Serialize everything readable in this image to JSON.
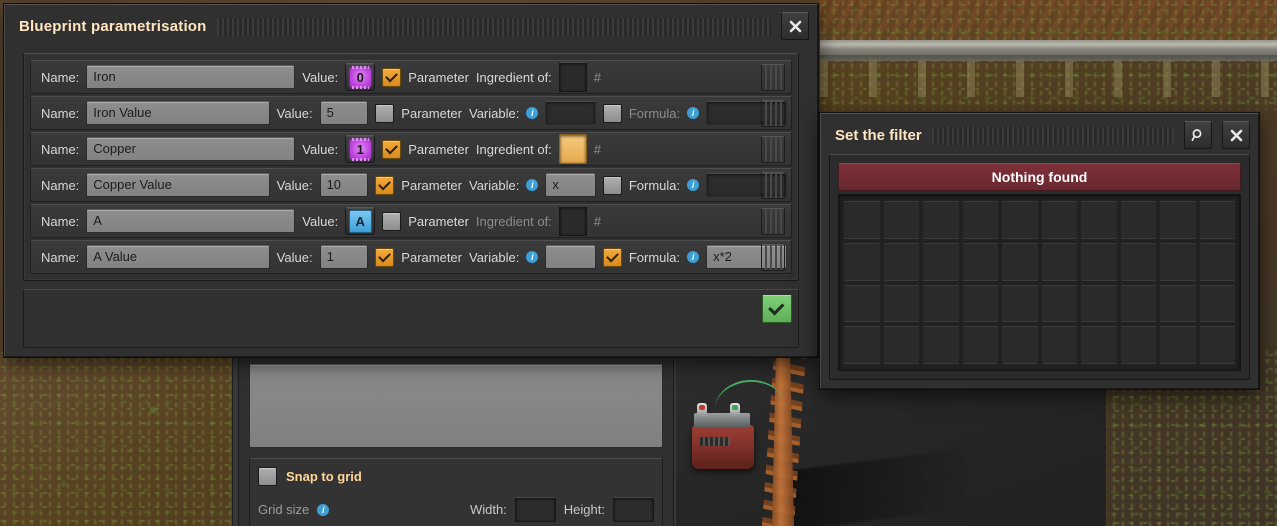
{
  "blueprint_window": {
    "title": "Blueprint parametrisation",
    "close_label": "✕",
    "confirm_label": "",
    "labels": {
      "name": "Name:",
      "value": "Value:",
      "parameter": "Parameter",
      "ingredient_of": "Ingredient of:",
      "variable": "Variable:",
      "formula": "Formula:",
      "hash": "#",
      "info": "i"
    },
    "rows": [
      {
        "name": "Iron",
        "value_type": "chip",
        "value": "0",
        "parameter_checked": true,
        "second_label": "Ingredient of:",
        "second_label_dim": false,
        "ingredient_filled": false,
        "hash": "#",
        "has_formula": false,
        "variable": "",
        "formula_checked": false,
        "formula": ""
      },
      {
        "name": "Iron Value",
        "value_type": "text",
        "value": "5",
        "parameter_checked": false,
        "second_label": "Variable:",
        "second_label_dim": false,
        "variable": "",
        "variable_dark": true,
        "has_formula": true,
        "formula_checked": false,
        "formula_label_dim": true,
        "formula": ""
      },
      {
        "name": "Copper",
        "value_type": "chip",
        "value": "1",
        "parameter_checked": true,
        "second_label": "Ingredient of:",
        "second_label_dim": false,
        "ingredient_filled": true,
        "hash": "#",
        "has_formula": false,
        "variable": "",
        "formula_checked": false,
        "formula": ""
      },
      {
        "name": "Copper Value",
        "value_type": "text",
        "value": "10",
        "parameter_checked": true,
        "second_label": "Variable:",
        "second_label_dim": false,
        "variable": "x",
        "variable_dark": false,
        "has_formula": true,
        "formula_checked": false,
        "formula_label_dim": false,
        "formula": ""
      },
      {
        "name": "A",
        "value_type": "signal",
        "value": "A",
        "parameter_checked": false,
        "second_label": "Ingredient of:",
        "second_label_dim": true,
        "ingredient_filled": false,
        "hash": "#",
        "has_formula": false,
        "variable": "",
        "formula_checked": false,
        "formula": ""
      },
      {
        "name": "A Value",
        "value_type": "text",
        "value": "1",
        "parameter_checked": true,
        "second_label": "Variable:",
        "second_label_dim": false,
        "variable": "",
        "variable_dark": false,
        "has_formula": true,
        "formula_checked": true,
        "formula_label_dim": false,
        "formula": "x*2"
      }
    ]
  },
  "filter_window": {
    "title": "Set the filter",
    "search_label": "⚲",
    "close_label": "✕",
    "nothing_found": "Nothing found",
    "grid_columns": 10,
    "grid_rows": 4
  },
  "blueprint_settings": {
    "snap_to_grid_label": "Snap to grid",
    "snap_to_grid_checked": false,
    "grid_size_label": "Grid size",
    "width_label": "Width:",
    "height_label": "Height:",
    "width_value": "",
    "height_value": ""
  },
  "colors": {
    "accent_title": "#ffe6c0",
    "checkbox_on": "#f2a93c",
    "parameter_chip": "#c34ae0",
    "signal_blue": "#79c8f5",
    "ingredient_orange": "#f5cb7e",
    "nothing_found_red": "#7e3038",
    "confirm_green": "#7fce78",
    "info_blue": "#3c9fd6"
  }
}
